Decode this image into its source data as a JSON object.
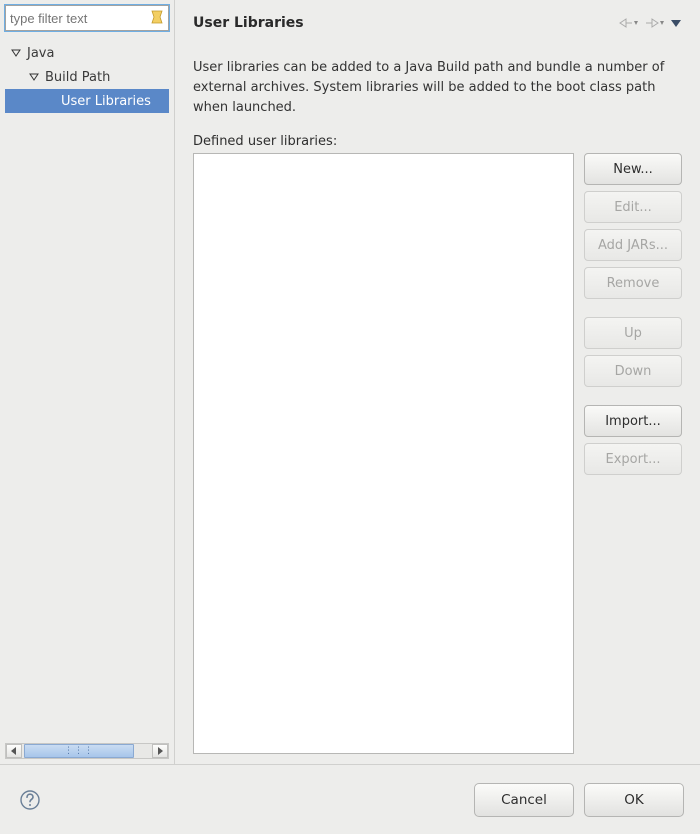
{
  "sidebar": {
    "filter_placeholder": "type filter text",
    "tree": {
      "java": {
        "label": "Java"
      },
      "build_path": {
        "label": "Build Path"
      },
      "user_libraries": {
        "label": "User Libraries"
      }
    }
  },
  "page": {
    "title": "User Libraries",
    "description": "User libraries can be added to a Java Build path and bundle a number of external archives. System libraries will be added to the boot class path when launched.",
    "defined_label": "Defined user libraries:"
  },
  "buttons": {
    "new": "New...",
    "edit": "Edit...",
    "add_jars": "Add JARs...",
    "remove": "Remove",
    "up": "Up",
    "down": "Down",
    "import": "Import...",
    "export": "Export..."
  },
  "footer": {
    "cancel": "Cancel",
    "ok": "OK"
  }
}
